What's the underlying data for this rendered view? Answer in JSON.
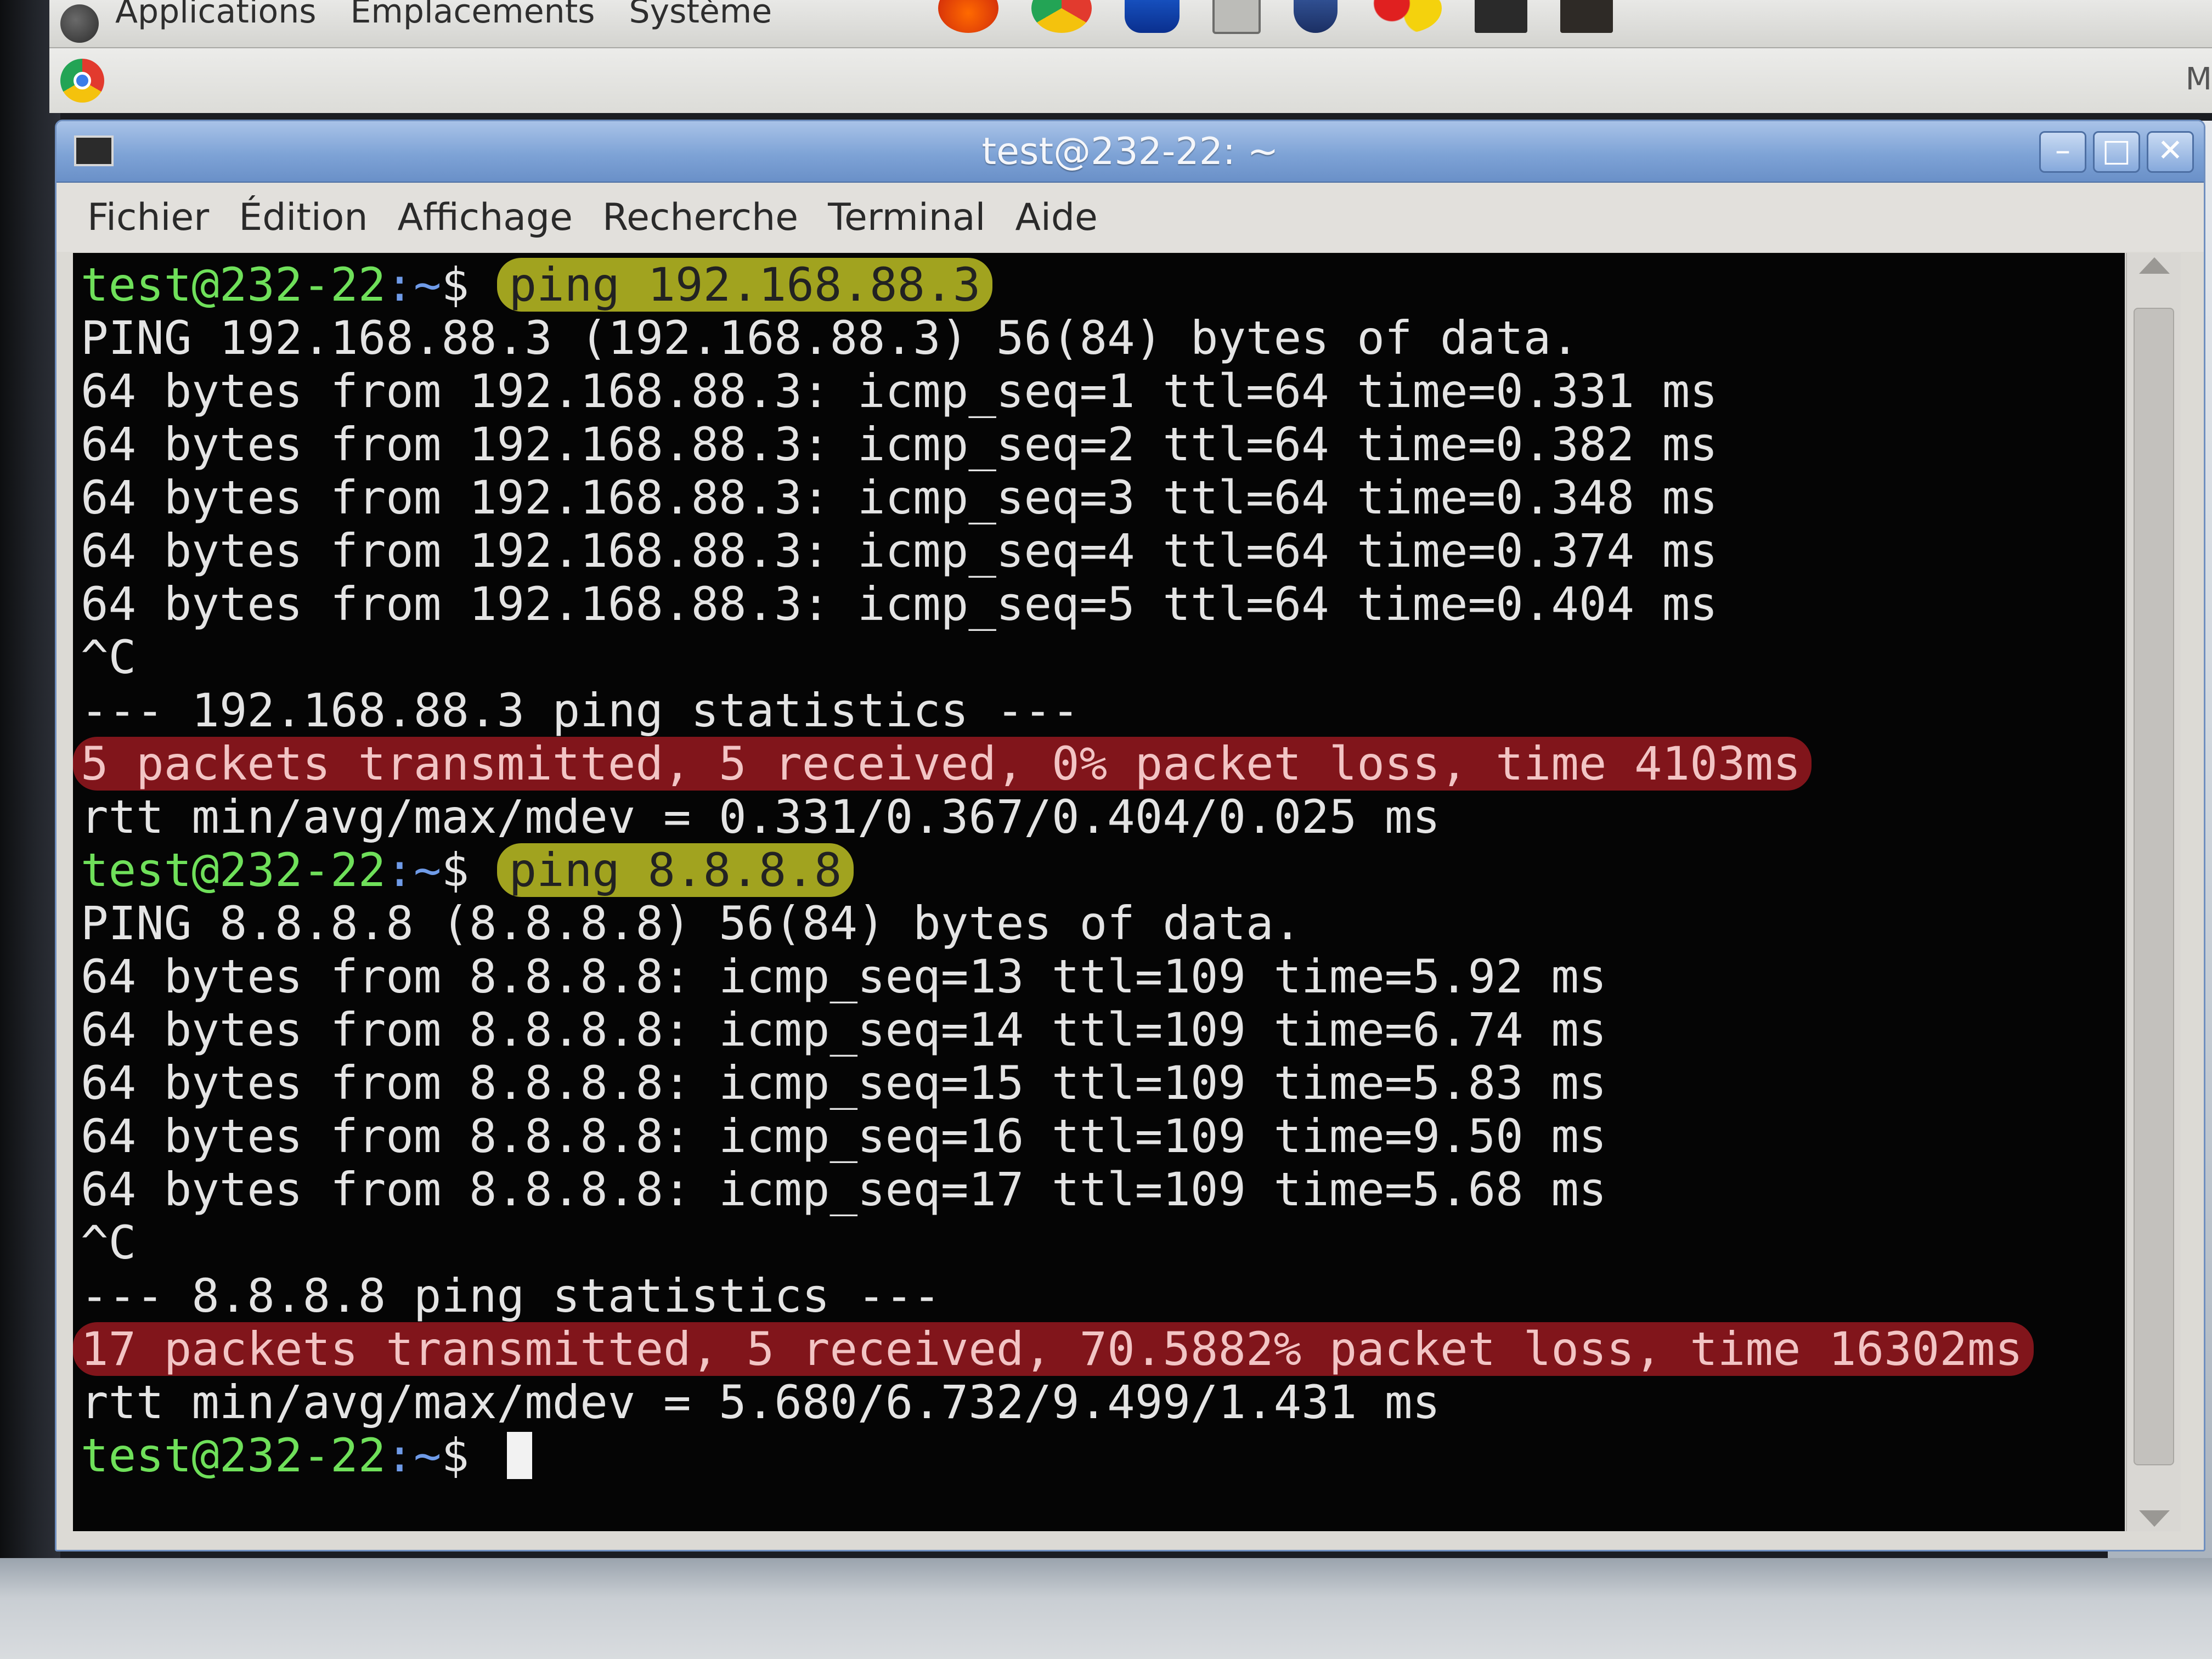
{
  "top_panel": {
    "menus": [
      "Applications",
      "Emplacements",
      "Système"
    ],
    "icons": [
      "firefox-icon",
      "chrome-icon",
      "blue-app-icon",
      "box-icon",
      "shield-icon",
      "dots-icon",
      "app-square-icon",
      "app-square-icon-2"
    ]
  },
  "second_bar": {
    "right_letter": "M"
  },
  "window": {
    "title": "test@232-22: ~",
    "buttons": {
      "minimize": "–",
      "maximize": "□",
      "close": "✕"
    },
    "menu": [
      "Fichier",
      "Édition",
      "Affichage",
      "Recherche",
      "Terminal",
      "Aide"
    ]
  },
  "terminal": {
    "prompt_user": "test@232-22",
    "prompt_path": ":~",
    "prompt_sym": "$ ",
    "cmd1": "ping 192.168.88.3",
    "ping1_header": "PING 192.168.88.3 (192.168.88.3) 56(84) bytes of data.",
    "ping1_replies": [
      "64 bytes from 192.168.88.3: icmp_seq=1 ttl=64 time=0.331 ms",
      "64 bytes from 192.168.88.3: icmp_seq=2 ttl=64 time=0.382 ms",
      "64 bytes from 192.168.88.3: icmp_seq=3 ttl=64 time=0.348 ms",
      "64 bytes from 192.168.88.3: icmp_seq=4 ttl=64 time=0.374 ms",
      "64 bytes from 192.168.88.3: icmp_seq=5 ttl=64 time=0.404 ms"
    ],
    "interrupt": "^C",
    "ping1_stats_title": "--- 192.168.88.3 ping statistics ---",
    "ping1_summary": "5 packets transmitted, 5 received, 0% packet loss, time 4103ms",
    "ping1_rtt": "rtt min/avg/max/mdev = 0.331/0.367/0.404/0.025 ms",
    "cmd2": "ping 8.8.8.8",
    "ping2_header": "PING 8.8.8.8 (8.8.8.8) 56(84) bytes of data.",
    "ping2_replies": [
      "64 bytes from 8.8.8.8: icmp_seq=13 ttl=109 time=5.92 ms",
      "64 bytes from 8.8.8.8: icmp_seq=14 ttl=109 time=6.74 ms",
      "64 bytes from 8.8.8.8: icmp_seq=15 ttl=109 time=5.83 ms",
      "64 bytes from 8.8.8.8: icmp_seq=16 ttl=109 time=9.50 ms",
      "64 bytes from 8.8.8.8: icmp_seq=17 ttl=109 time=5.68 ms"
    ],
    "ping2_stats_title": "--- 8.8.8.8 ping statistics ---",
    "ping2_summary": "17 packets transmitted, 5 received, 70.5882% packet loss, time 16302ms",
    "ping2_rtt": "rtt min/avg/max/mdev = 5.680/6.732/9.499/1.431 ms"
  },
  "colors": {
    "prompt_user": "#6fe05a",
    "prompt_path": "#6f9be8",
    "highlight_yellow": "#c4c726",
    "highlight_red": "#961820",
    "terminal_bg": "#050505",
    "titlebar": "#7ea3d6"
  }
}
